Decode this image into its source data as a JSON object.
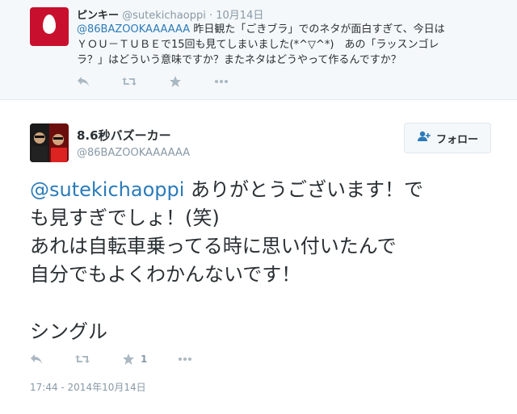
{
  "reply_tweet": {
    "name": "ピンキー",
    "handle": "@sutekichaoppi",
    "separator": "·",
    "time": "10月14日",
    "mention": "@86BAZOOKAAAAAA",
    "text_line1": " 昨日観た「ごきブラ」でのネタが面白すぎて、今日は",
    "text_line2": "ＹＯＵ－ＴＵＢＥで15回も見てしまいました(*^▽^*)　あの「ラッスンゴレ",
    "text_line3": "ラ？」はどういう意味ですか？またネタはどうやって作るんですか？",
    "actions": [
      "reply-icon",
      "retweet-icon",
      "favorite-icon",
      "more-icon"
    ]
  },
  "main_tweet": {
    "name": "8.6秒バズーカー",
    "handle": "@86BAZOOKAAAAAA",
    "follow_label": "フォロー",
    "mention": "@sutekichaoppi",
    "line1_rest": " ありがとうございます！で",
    "line2": "も見すぎでしょ！(笑)",
    "line3": "あれは自転車乗ってる時に思い付いたんで",
    "line4": "自分でもよくわかんないです！",
    "line5": "シングル",
    "favorite_count": "1",
    "timestamp": "17:44 - 2014年10月14日"
  },
  "colors": {
    "link": "#2b7bb9",
    "muted": "#8899a6",
    "text": "#292f33",
    "reply_bg": "#f5f8fa",
    "avatar_red": "#c8102e"
  }
}
